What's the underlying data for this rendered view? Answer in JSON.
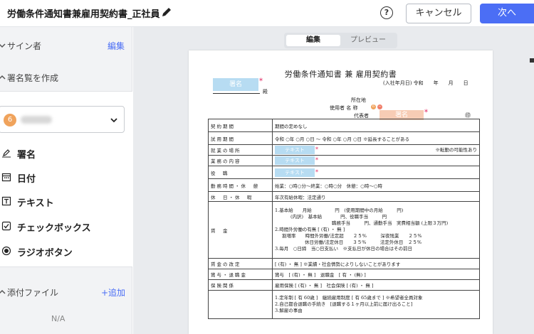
{
  "header": {
    "title": "労働条件通知書兼雇用契約書_正社員",
    "help_label": "?",
    "cancel_label": "キャンセル",
    "next_label": "次へ"
  },
  "sidebar": {
    "signers_label": "サイン者",
    "edit_label": "編集",
    "create_signature_label": "署名覧を作成",
    "signer_avatar_letter": "6",
    "fields": [
      {
        "label": "署名",
        "icon": "signature-pen-icon"
      },
      {
        "label": "日付",
        "icon": "calendar-icon"
      },
      {
        "label": "テキスト",
        "icon": "text-field-icon"
      },
      {
        "label": "チェックボックス",
        "icon": "checkbox-icon"
      },
      {
        "label": "ラジオボタン",
        "icon": "radio-button-icon"
      }
    ],
    "attachments_label": "添付ファイル",
    "add_label": "+追加",
    "attachments_value": "N/A"
  },
  "view_tabs": {
    "edit": "編集",
    "preview": "プレビュー"
  },
  "document": {
    "title": "労働条件通知書 兼 雇用契約書",
    "hire_date": "(入社年月日) 令和　　年　　月　　日",
    "signature_placeholder": "署名",
    "honorific": "殿",
    "address_label": "所在地",
    "employer_label": "使用者 名 称",
    "representative_label": "代表者",
    "seal_mark": "㊞",
    "text_placeholder": "テキスト",
    "rows": {
      "contract_period_h": "契約期間",
      "contract_period_v": "期間の定めなし",
      "trial_h": "試用期間",
      "trial_v": "令和 ○年 ○月 ○日 ～ 令和 ○年 ○月 ○日 ※延長することがある",
      "workplace_h": "就業の場所",
      "workplace_note": "※転勤の可能性あり",
      "duties_h": "業務の内容",
      "position_h": "役　職",
      "hours_h": "勤務時間・休　憩",
      "hours_v": "始業：○時○分～終業：○時○分　休憩：○時～○時",
      "holidays_h": "休　日・休　暇",
      "holidays_v": "年次有給休暇：法定通り",
      "wage_h": "賃　金",
      "wage_l1": "1.基本給　　月給　　　　　円　(使用期間中の月給　　　円)",
      "wage_l2": "(内訳)　基本給　　　　円、役職手当　　　円",
      "wage_l3": "職務手当　　　円、通勤手当　実費相当額 (上限３万円)",
      "wage_l4": "2.時間外労働の有無 [ (有) ・ 無 ]",
      "wage_l5": "割増率　　時間外労働/法定超　　２５%　　　深夜残業　　２５%",
      "wage_l6": "休日労働/法定休日　　３５%　　　法定外休日　２５%",
      "wage_l7": "3.毎月　○日締　当○日支払い　※支払日が休日の場合はその前日",
      "raise_h": "賃金の改定",
      "raise_v": "[ (有) ・ 無 ] ※業績・社会情勢によりしないことがあります",
      "bonus_h": "賞与・退職金",
      "bonus_v": "賞与　[ (有) ・ 無 ]　退職金　[ 有 ・ (無) ]",
      "insurance_h": "保険関係",
      "insurance_v": "雇用保険 [ (有) ・ 無 ]　社会保険 [ (有) ・ 無 ]",
      "retire_l1": "1.定年制 [ 有 60歳 ]　継続雇用制度 [ 有 65歳まで ] ※希望者全員対象",
      "retire_l2": "2.自己都合退職の手続き　[退職する１ヶ月以上前に届け出ること]",
      "retire_l3": "3.解雇の事由"
    }
  },
  "colors": {
    "accent": "#4b6ef5",
    "field_blue": "#b7dcf2",
    "field_orange": "#f7ccb5",
    "required_star": "#e0245e"
  }
}
